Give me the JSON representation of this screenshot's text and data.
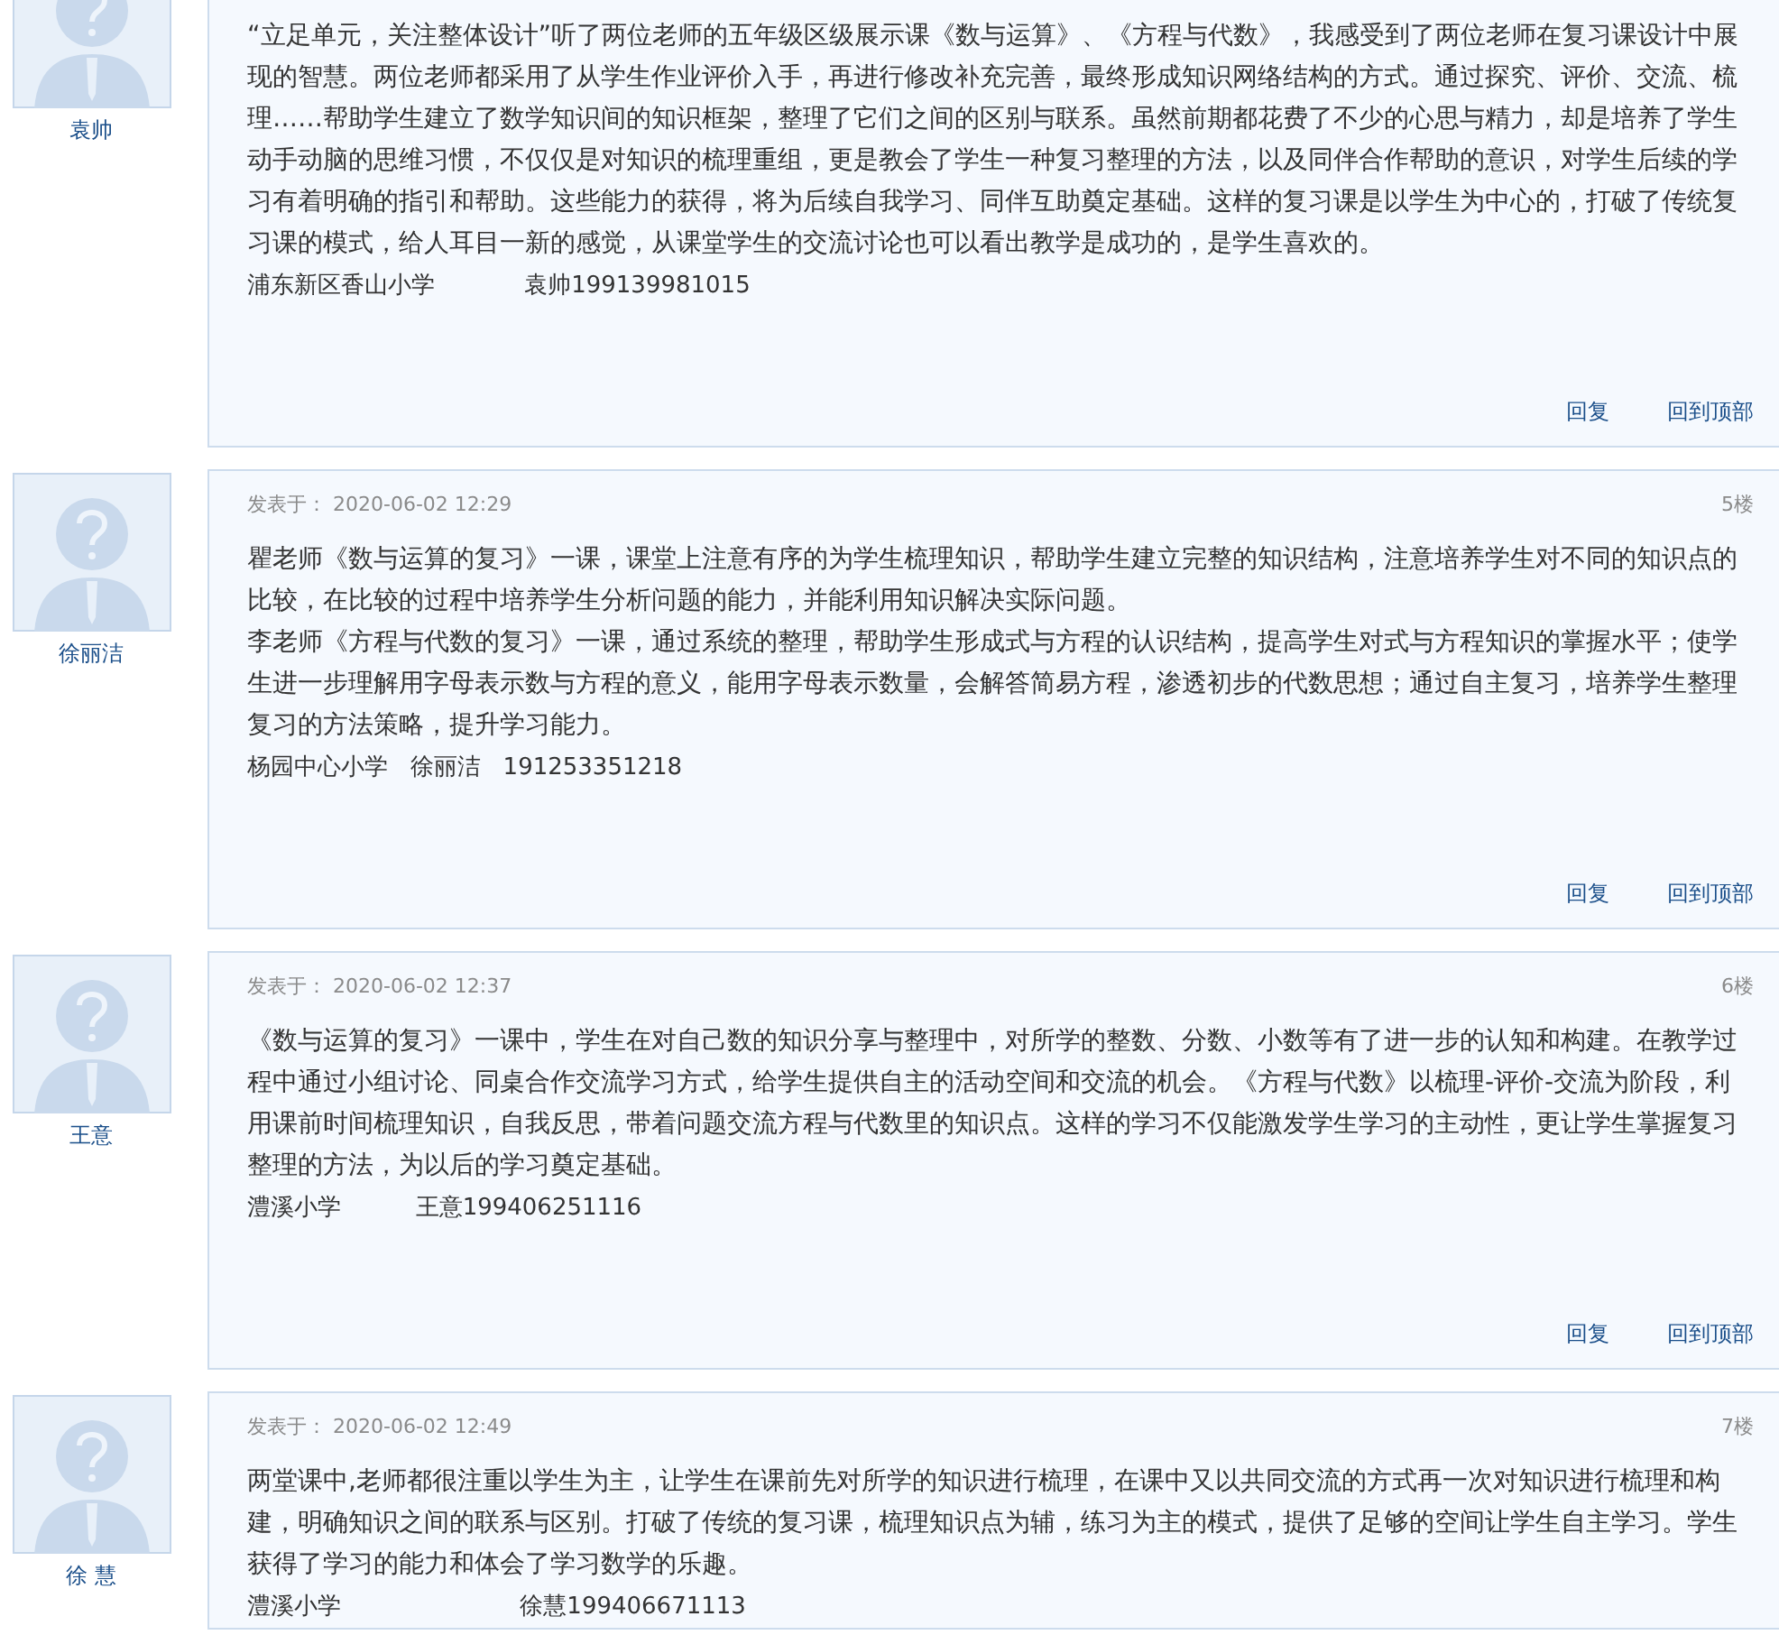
{
  "posts": [
    {
      "author": "袁帅",
      "paragraphs": [
        "“立足单元，关注整体设计”听了两位老师的五年级区级展示课《数与运算》、《方程与代数》，我感受到了两位老师在复习课设计中展现的智慧。两位老师都采用了从学生作业评价入手，再进行修改补充完善，最终形成知识网络结构的方式。通过探究、评价、交流、梳理……帮助学生建立了数学知识间的知识框架，整理了它们之间的区别与联系。虽然前期都花费了不少的心思与精力，却是培养了学生动手动脑的思维习惯，不仅仅是对知识的梳理重组，更是教会了学生一种复习整理的方法，以及同伴合作帮助的意识，对学生后续的学习有着明确的指引和帮助。这些能力的获得，将为后续自我学习、同伴互助奠定基础。这样的复习课是以学生为中心的，打破了传统复习课的模式，给人耳目一新的感觉，从课堂学生的交流讨论也可以看出教学是成功的，是学生喜欢的。"
      ],
      "signature": "浦东新区香山小学            袁帅199139981015",
      "actions": [
        "回复",
        "回到顶部"
      ]
    },
    {
      "author": "徐丽洁",
      "posted": "发表于： 2020-06-02 12:29",
      "floor": "5楼",
      "paragraphs": [
        "瞿老师《数与运算的复习》一课，课堂上注意有序的为学生梳理知识，帮助学生建立完整的知识结构，注意培养学生对不同的知识点的比较，在比较的过程中培养学生分析问题的能力，并能利用知识解决实际问题。",
        "李老师《方程与代数的复习》一课，通过系统的整理，帮助学生形成式与方程的认识结构，提高学生对式与方程知识的掌握水平；使学生进一步理解用字母表示数与方程的意义，能用字母表示数量，会解答简易方程，渗透初步的代数思想；通过自主复习，培养学生整理复习的方法策略，提升学习能力。"
      ],
      "signature": "杨园中心小学   徐丽洁   191253351218",
      "actions": [
        "回复",
        "回到顶部"
      ]
    },
    {
      "author": "王意",
      "posted": "发表于： 2020-06-02 12:37",
      "floor": "6楼",
      "paragraphs": [
        "《数与运算的复习》一课中，学生在对自己数的知识分享与整理中，对所学的整数、分数、小数等有了进一步的认知和构建。在教学过程中通过小组讨论、同桌合作交流学习方式，给学生提供自主的活动空间和交流的机会。《方程与代数》以梳理-评价-交流为阶段，利用课前时间梳理知识，自我反思，带着问题交流方程与代数里的知识点。这样的学习不仅能激发学生学习的主动性，更让学生掌握复习整理的方法，为以后的学习奠定基础。"
      ],
      "signature": "澧溪小学          王意199406251116",
      "actions": [
        "回复",
        "回到顶部"
      ]
    },
    {
      "author": "徐 慧",
      "posted": "发表于： 2020-06-02 12:49",
      "floor": "7楼",
      "paragraphs": [
        "两堂课中,老师都很注重以学生为主，让学生在课前先对所学的知识进行梳理，在课中又以共同交流的方式再一次对知识进行梳理和构建，明确知识之间的联系与区别。打破了传统的复习课，梳理知识点为辅，练习为主的模式，提供了足够的空间让学生自主学习。学生获得了学习的能力和体会了学习数学的乐趣。"
      ],
      "signature": "澧溪小学                        徐慧199406671113"
    }
  ]
}
